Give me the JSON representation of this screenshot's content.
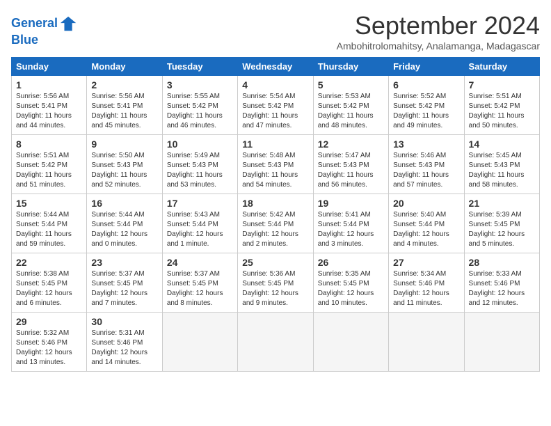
{
  "header": {
    "logo_line1": "General",
    "logo_line2": "Blue",
    "month_title": "September 2024",
    "subtitle": "Ambohitrolomahitsy, Analamanga, Madagascar"
  },
  "weekdays": [
    "Sunday",
    "Monday",
    "Tuesday",
    "Wednesday",
    "Thursday",
    "Friday",
    "Saturday"
  ],
  "days": [
    {
      "date": "1",
      "sunrise": "Sunrise: 5:56 AM",
      "sunset": "Sunset: 5:41 PM",
      "daylight": "Daylight: 11 hours and 44 minutes."
    },
    {
      "date": "2",
      "sunrise": "Sunrise: 5:56 AM",
      "sunset": "Sunset: 5:41 PM",
      "daylight": "Daylight: 11 hours and 45 minutes."
    },
    {
      "date": "3",
      "sunrise": "Sunrise: 5:55 AM",
      "sunset": "Sunset: 5:42 PM",
      "daylight": "Daylight: 11 hours and 46 minutes."
    },
    {
      "date": "4",
      "sunrise": "Sunrise: 5:54 AM",
      "sunset": "Sunset: 5:42 PM",
      "daylight": "Daylight: 11 hours and 47 minutes."
    },
    {
      "date": "5",
      "sunrise": "Sunrise: 5:53 AM",
      "sunset": "Sunset: 5:42 PM",
      "daylight": "Daylight: 11 hours and 48 minutes."
    },
    {
      "date": "6",
      "sunrise": "Sunrise: 5:52 AM",
      "sunset": "Sunset: 5:42 PM",
      "daylight": "Daylight: 11 hours and 49 minutes."
    },
    {
      "date": "7",
      "sunrise": "Sunrise: 5:51 AM",
      "sunset": "Sunset: 5:42 PM",
      "daylight": "Daylight: 11 hours and 50 minutes."
    },
    {
      "date": "8",
      "sunrise": "Sunrise: 5:51 AM",
      "sunset": "Sunset: 5:42 PM",
      "daylight": "Daylight: 11 hours and 51 minutes."
    },
    {
      "date": "9",
      "sunrise": "Sunrise: 5:50 AM",
      "sunset": "Sunset: 5:43 PM",
      "daylight": "Daylight: 11 hours and 52 minutes."
    },
    {
      "date": "10",
      "sunrise": "Sunrise: 5:49 AM",
      "sunset": "Sunset: 5:43 PM",
      "daylight": "Daylight: 11 hours and 53 minutes."
    },
    {
      "date": "11",
      "sunrise": "Sunrise: 5:48 AM",
      "sunset": "Sunset: 5:43 PM",
      "daylight": "Daylight: 11 hours and 54 minutes."
    },
    {
      "date": "12",
      "sunrise": "Sunrise: 5:47 AM",
      "sunset": "Sunset: 5:43 PM",
      "daylight": "Daylight: 11 hours and 56 minutes."
    },
    {
      "date": "13",
      "sunrise": "Sunrise: 5:46 AM",
      "sunset": "Sunset: 5:43 PM",
      "daylight": "Daylight: 11 hours and 57 minutes."
    },
    {
      "date": "14",
      "sunrise": "Sunrise: 5:45 AM",
      "sunset": "Sunset: 5:43 PM",
      "daylight": "Daylight: 11 hours and 58 minutes."
    },
    {
      "date": "15",
      "sunrise": "Sunrise: 5:44 AM",
      "sunset": "Sunset: 5:44 PM",
      "daylight": "Daylight: 11 hours and 59 minutes."
    },
    {
      "date": "16",
      "sunrise": "Sunrise: 5:44 AM",
      "sunset": "Sunset: 5:44 PM",
      "daylight": "Daylight: 12 hours and 0 minutes."
    },
    {
      "date": "17",
      "sunrise": "Sunrise: 5:43 AM",
      "sunset": "Sunset: 5:44 PM",
      "daylight": "Daylight: 12 hours and 1 minute."
    },
    {
      "date": "18",
      "sunrise": "Sunrise: 5:42 AM",
      "sunset": "Sunset: 5:44 PM",
      "daylight": "Daylight: 12 hours and 2 minutes."
    },
    {
      "date": "19",
      "sunrise": "Sunrise: 5:41 AM",
      "sunset": "Sunset: 5:44 PM",
      "daylight": "Daylight: 12 hours and 3 minutes."
    },
    {
      "date": "20",
      "sunrise": "Sunrise: 5:40 AM",
      "sunset": "Sunset: 5:44 PM",
      "daylight": "Daylight: 12 hours and 4 minutes."
    },
    {
      "date": "21",
      "sunrise": "Sunrise: 5:39 AM",
      "sunset": "Sunset: 5:45 PM",
      "daylight": "Daylight: 12 hours and 5 minutes."
    },
    {
      "date": "22",
      "sunrise": "Sunrise: 5:38 AM",
      "sunset": "Sunset: 5:45 PM",
      "daylight": "Daylight: 12 hours and 6 minutes."
    },
    {
      "date": "23",
      "sunrise": "Sunrise: 5:37 AM",
      "sunset": "Sunset: 5:45 PM",
      "daylight": "Daylight: 12 hours and 7 minutes."
    },
    {
      "date": "24",
      "sunrise": "Sunrise: 5:37 AM",
      "sunset": "Sunset: 5:45 PM",
      "daylight": "Daylight: 12 hours and 8 minutes."
    },
    {
      "date": "25",
      "sunrise": "Sunrise: 5:36 AM",
      "sunset": "Sunset: 5:45 PM",
      "daylight": "Daylight: 12 hours and 9 minutes."
    },
    {
      "date": "26",
      "sunrise": "Sunrise: 5:35 AM",
      "sunset": "Sunset: 5:45 PM",
      "daylight": "Daylight: 12 hours and 10 minutes."
    },
    {
      "date": "27",
      "sunrise": "Sunrise: 5:34 AM",
      "sunset": "Sunset: 5:46 PM",
      "daylight": "Daylight: 12 hours and 11 minutes."
    },
    {
      "date": "28",
      "sunrise": "Sunrise: 5:33 AM",
      "sunset": "Sunset: 5:46 PM",
      "daylight": "Daylight: 12 hours and 12 minutes."
    },
    {
      "date": "29",
      "sunrise": "Sunrise: 5:32 AM",
      "sunset": "Sunset: 5:46 PM",
      "daylight": "Daylight: 12 hours and 13 minutes."
    },
    {
      "date": "30",
      "sunrise": "Sunrise: 5:31 AM",
      "sunset": "Sunset: 5:46 PM",
      "daylight": "Daylight: 12 hours and 14 minutes."
    }
  ]
}
